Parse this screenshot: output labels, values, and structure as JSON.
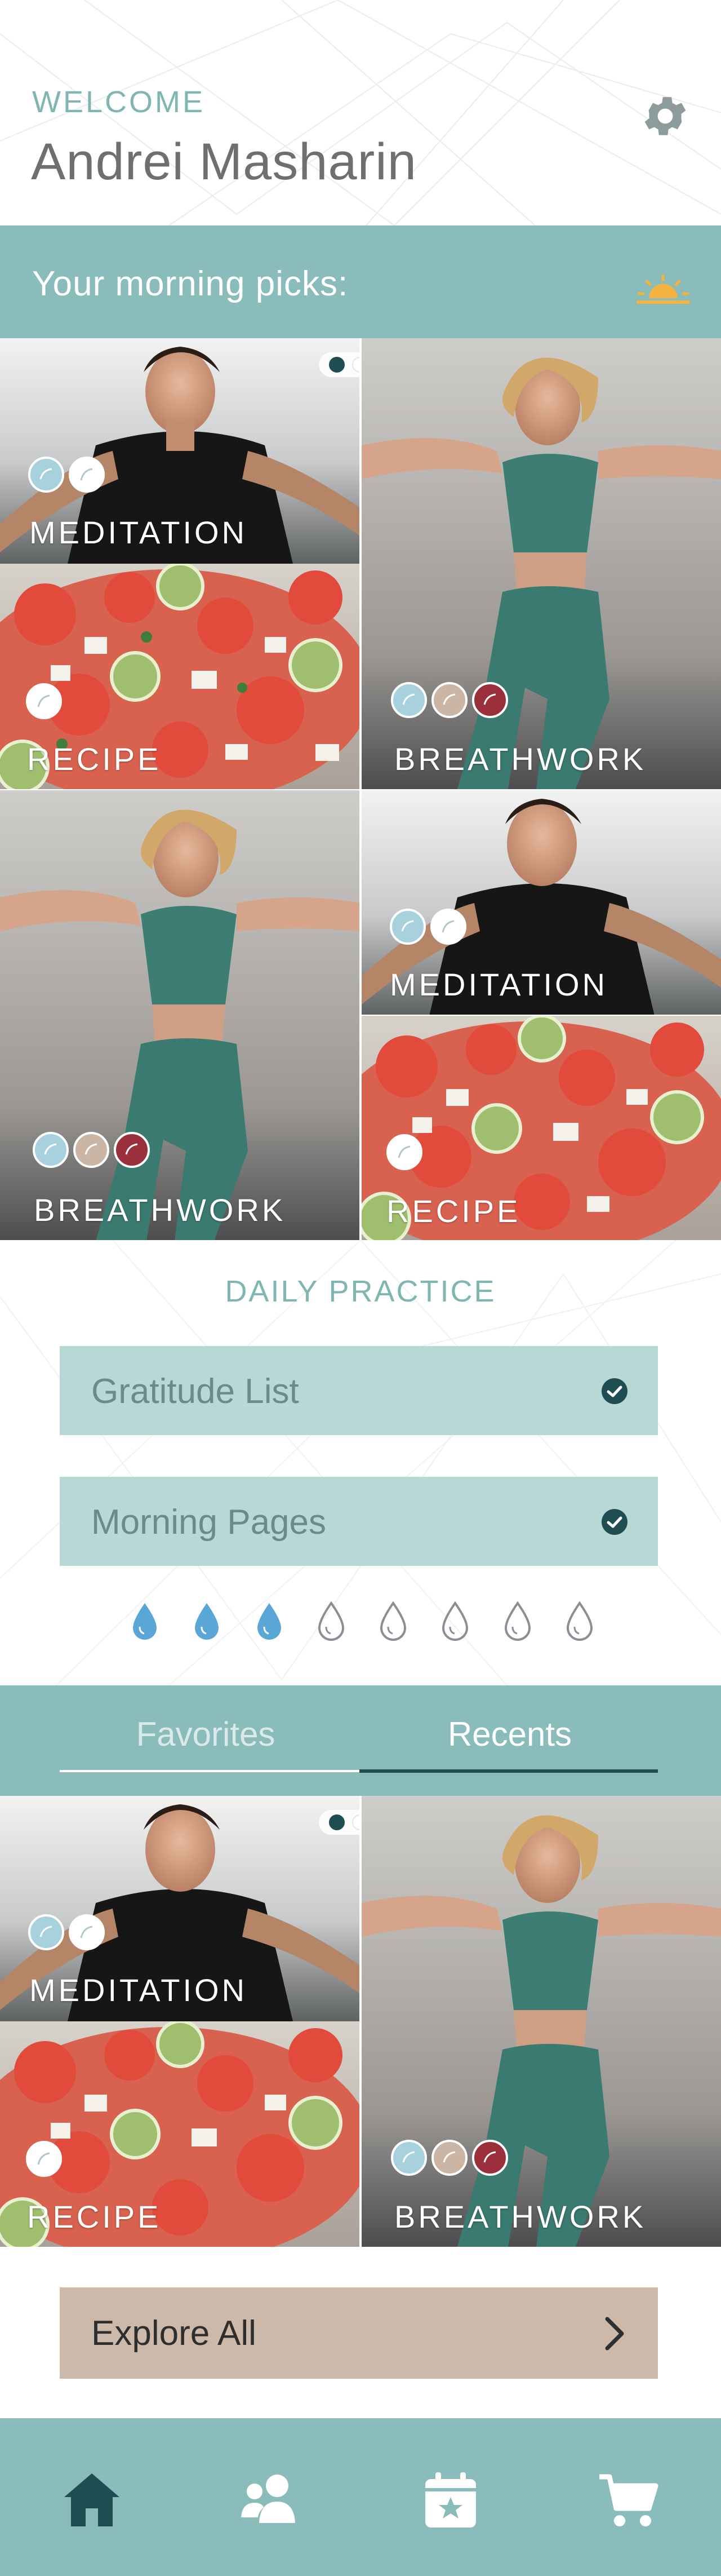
{
  "header": {
    "welcome": "WELCOME",
    "user_name": "Andrei Masharin",
    "settings_icon": "gear-icon"
  },
  "morning": {
    "title": "Your morning picks:",
    "icon": "sunrise-icon"
  },
  "picks": [
    {
      "label": "MEDITATION",
      "kind": "meditation"
    },
    {
      "label": "RECIPE",
      "kind": "recipe"
    },
    {
      "label": "BREATHWORK",
      "kind": "breathwork"
    },
    {
      "label": "BREATHWORK",
      "kind": "breathwork"
    },
    {
      "label": "MEDITATION",
      "kind": "meditation"
    },
    {
      "label": "RECIPE",
      "kind": "recipe"
    }
  ],
  "daily_practice": {
    "title": "DAILY PRACTICE",
    "items": [
      {
        "label": "Gratitude List",
        "done": true
      },
      {
        "label": "Morning Pages",
        "done": true
      }
    ],
    "water": {
      "filled": 3,
      "total": 8
    }
  },
  "tabs": {
    "favorites": "Favorites",
    "recents": "Recents",
    "active": "recents"
  },
  "recents": [
    {
      "label": "MEDITATION",
      "kind": "meditation"
    },
    {
      "label": "RECIPE",
      "kind": "recipe"
    },
    {
      "label": "BREATHWORK",
      "kind": "breathwork"
    }
  ],
  "explore": {
    "label": "Explore All"
  },
  "bottom_nav": [
    {
      "icon": "home-icon",
      "active": true
    },
    {
      "icon": "community-icon",
      "active": false
    },
    {
      "icon": "calendar-icon",
      "active": false
    },
    {
      "icon": "cart-icon",
      "active": false
    }
  ],
  "colors": {
    "teal": "#89bcba",
    "light_teal": "#b7d8d5",
    "dark_teal": "#1f4d52",
    "tan": "#cdb9aa",
    "accent_blue": "#5aa6d6"
  }
}
